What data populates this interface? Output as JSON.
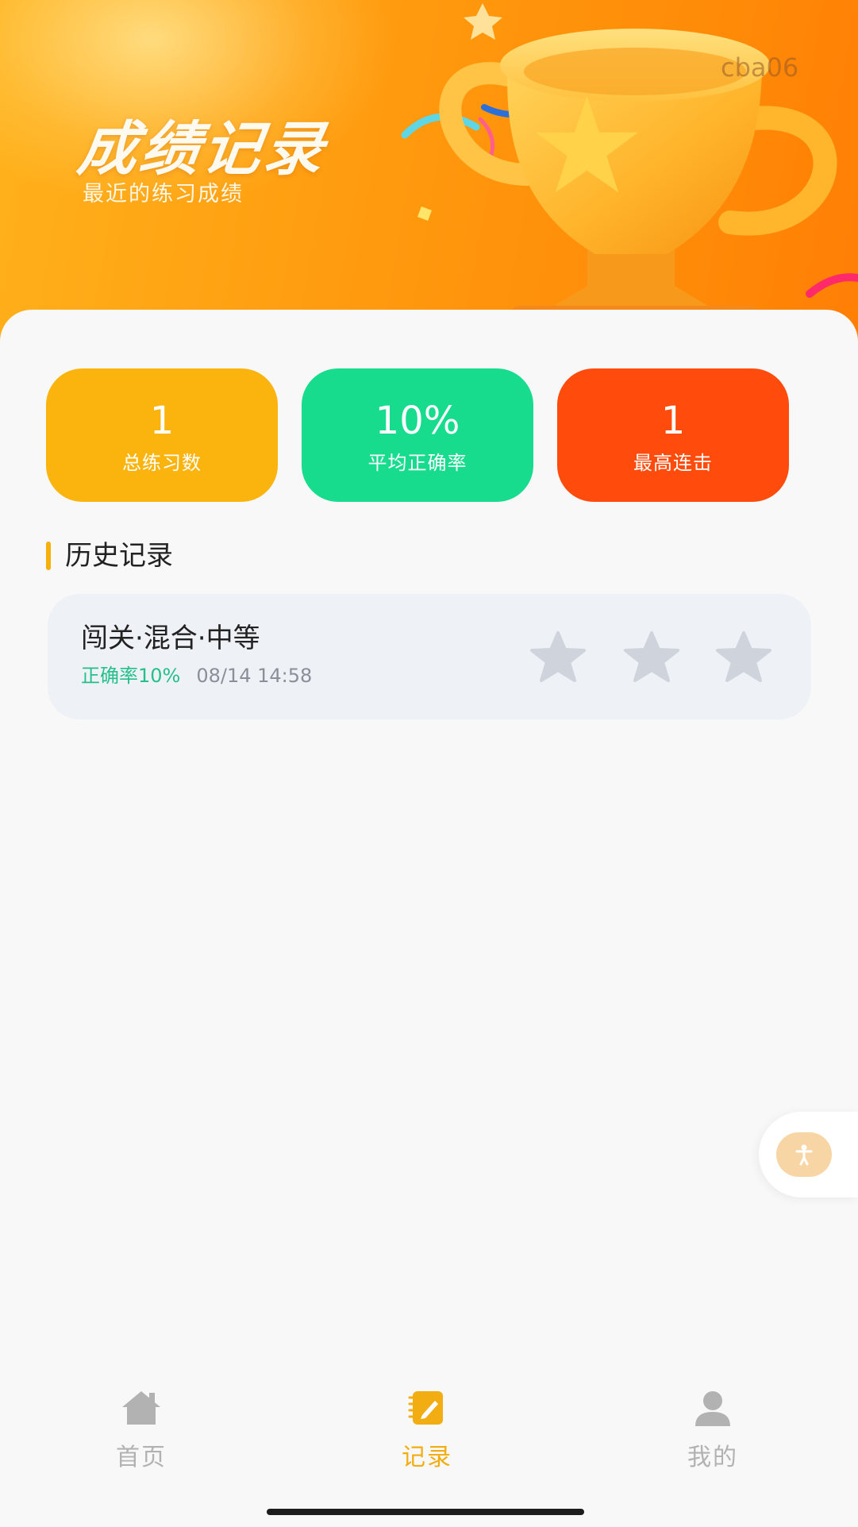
{
  "header": {
    "title": "成绩记录",
    "subtitle": "最近的练习成绩",
    "watermark": "cba06"
  },
  "stats": [
    {
      "value": "1",
      "label": "总练习数",
      "color": "#fbb40e"
    },
    {
      "value": "10%",
      "label": "平均正确率",
      "color": "#17dc8e"
    },
    {
      "value": "1",
      "label": "最高连击",
      "color": "#ff4b0c"
    }
  ],
  "history": {
    "section_title": "历史记录",
    "records": [
      {
        "title": "闯关·混合·中等",
        "accuracy": "正确率10%",
        "time": "08/14 14:58",
        "stars_earned": 0,
        "stars_total": 3
      }
    ]
  },
  "colors": {
    "accent": "#f5b10a",
    "star_empty": "#cfd3dc",
    "accuracy_text": "#25c08a",
    "tab_active": "#f2ad12",
    "tab_inactive": "#b2b2b2"
  },
  "tabbar": {
    "tabs": [
      {
        "label": "首页",
        "icon": "home-icon",
        "active": false
      },
      {
        "label": "记录",
        "icon": "record-icon",
        "active": true
      },
      {
        "label": "我的",
        "icon": "profile-icon",
        "active": false
      }
    ]
  },
  "floating": {
    "icon": "accessibility-icon"
  }
}
